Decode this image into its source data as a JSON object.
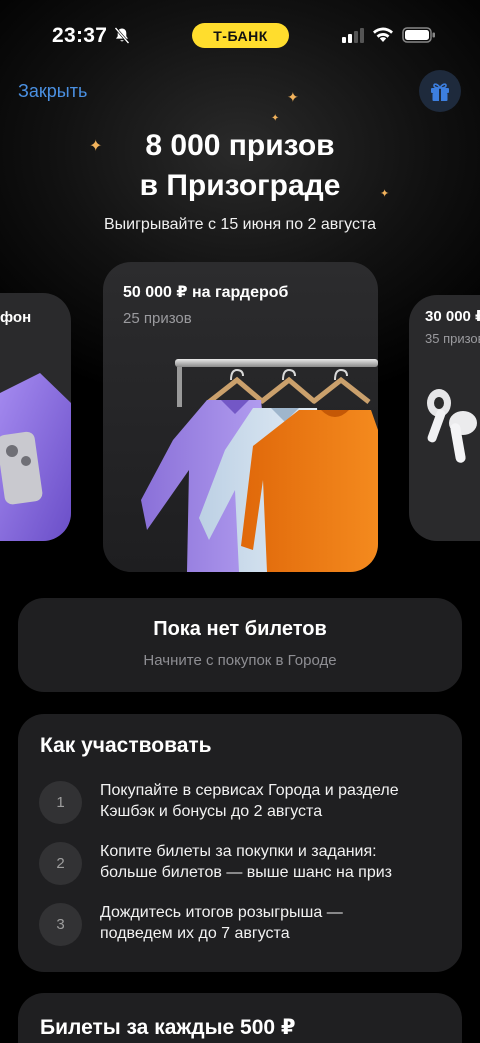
{
  "status_bar": {
    "time": "23:37",
    "brand": "Т-БАНК",
    "brand_color": "#ffdd2d",
    "icons": [
      "bell-slash-icon",
      "signal-icon",
      "wifi-icon",
      "battery-icon"
    ]
  },
  "header": {
    "close_label": "Закрыть",
    "gift_icon": "gift-icon",
    "link_color": "#4a90e2"
  },
  "hero": {
    "title_line1": "8 000 призов",
    "title_line2": "в Призограде",
    "subtitle": "Выигрывайте с 15 июня по 2 августа"
  },
  "prizes": [
    {
      "title": "фон",
      "count": ""
    },
    {
      "title": "50 000 ₽ на гардероб",
      "count": "25 призов"
    },
    {
      "title": "30 000 ₽",
      "count": "35 призов"
    }
  ],
  "no_tickets": {
    "title": "Пока нет билетов",
    "subtitle": "Начните с покупок в Городе"
  },
  "how_to": {
    "title": "Как участвовать",
    "steps": [
      {
        "num": "1",
        "line1": "Покупайте в сервисах Города и разделе",
        "line2": "Кэшбэк и бонусы до 2 августа"
      },
      {
        "num": "2",
        "line1": "Копите билеты за покупки и задания:",
        "line2": "больше билетов — выше шанс на приз"
      },
      {
        "num": "3",
        "line1": "Дождитесь итогов розыгрыша —",
        "line2": "подведем их до 7 августа"
      }
    ]
  },
  "tickets_section": {
    "title": "Билеты за каждые 500 ₽"
  }
}
